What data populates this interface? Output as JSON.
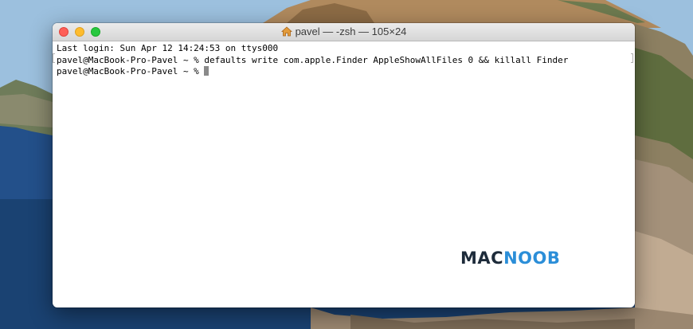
{
  "window": {
    "title": "pavel — -zsh — 105×24",
    "title_icon": "home-icon"
  },
  "terminal": {
    "lines": [
      "Last login: Sun Apr 12 14:24:53 on ttys000",
      "pavel@MacBook-Pro-Pavel ~ % defaults write com.apple.Finder AppleShowAllFiles 0 && killall Finder",
      "pavel@MacBook-Pro-Pavel ~ % "
    ]
  },
  "watermark": {
    "part1": "MAC",
    "part2": "NOOB"
  },
  "colors": {
    "close": "#fe5f57",
    "minimize": "#febc2e",
    "zoom": "#28c840",
    "watermark_dark": "#1d2b3a",
    "watermark_blue": "#2b8ed8"
  }
}
